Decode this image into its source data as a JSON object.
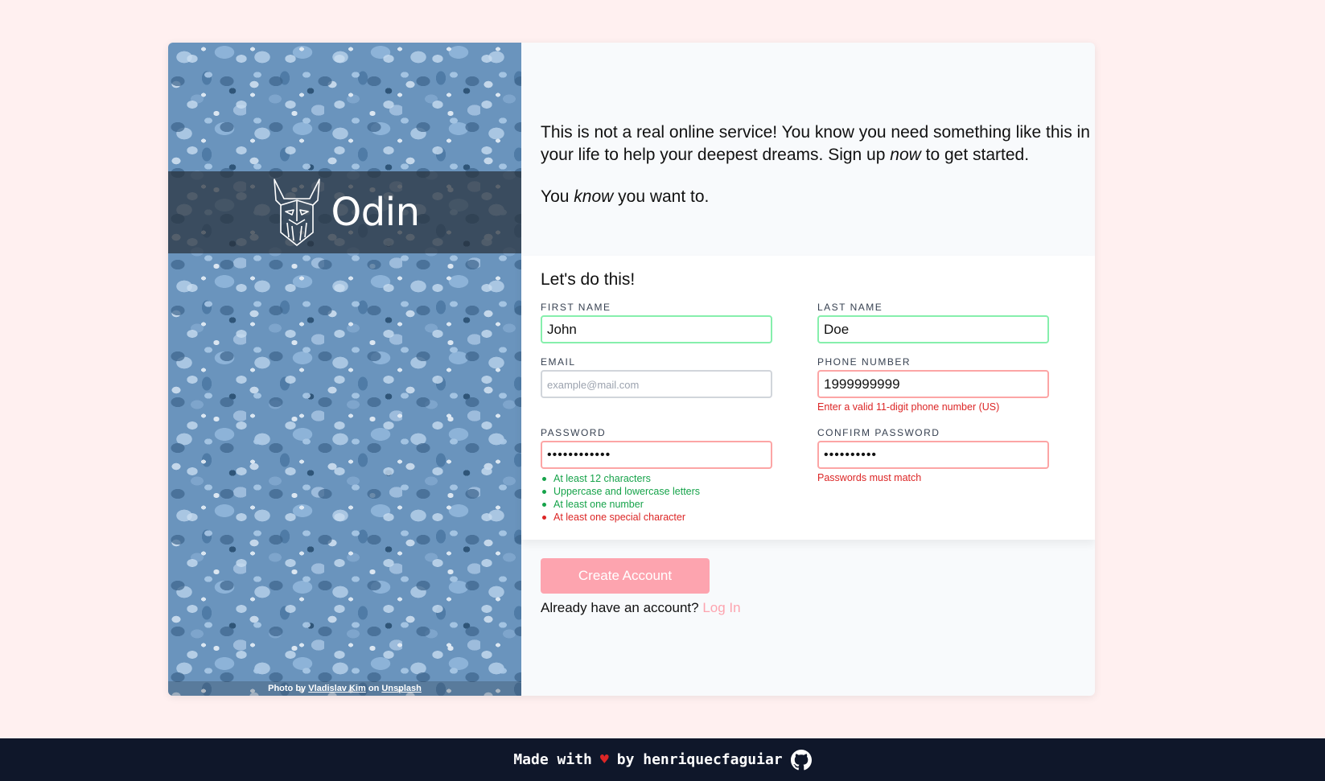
{
  "hero": {
    "brand_name": "Odin",
    "credit_prefix": "Photo by",
    "credit_author": "Vladislav Kim",
    "credit_mid": "on",
    "credit_site": "Unsplash"
  },
  "intro": {
    "line1_a": "This is not a real online service! You know you need something like this in your life to help your deepest dreams. Sign up ",
    "line1_em": "now",
    "line1_b": " to get started.",
    "line2_a": "You ",
    "line2_em": "know",
    "line2_b": " you want to."
  },
  "form": {
    "title": "Let's do this!",
    "first_name": {
      "label": "FIRST NAME",
      "value": "John"
    },
    "last_name": {
      "label": "LAST NAME",
      "value": "Doe"
    },
    "email": {
      "label": "EMAIL",
      "value": "",
      "placeholder": "example@mail.com"
    },
    "phone": {
      "label": "PHONE NUMBER",
      "value": "1999999999",
      "error": "Enter a valid 11-digit phone number (US)"
    },
    "password": {
      "label": "PASSWORD",
      "value": "••••••••••••",
      "rules": [
        {
          "text": "At least 12 characters",
          "status": "ok"
        },
        {
          "text": "Uppercase and lowercase letters",
          "status": "ok"
        },
        {
          "text": "At least one number",
          "status": "ok"
        },
        {
          "text": "At least one special character",
          "status": "bad"
        }
      ]
    },
    "confirm_password": {
      "label": "CONFIRM PASSWORD",
      "value": "••••••••••",
      "error": "Passwords must match"
    }
  },
  "actions": {
    "create_label": "Create Account",
    "login_prompt": "Already have an account?",
    "login_link": "Log In"
  },
  "footer": {
    "made_with": "Made with",
    "heart": "♥",
    "by": "by henriquecfaguiar"
  },
  "colors": {
    "background": "#fff0f0",
    "valid": "#86efac",
    "invalid": "#fca5a5",
    "accent": "#fda4af",
    "footer": "#0f172a"
  },
  "icons": {
    "brand": "odin-logo-icon",
    "footer": "github-icon"
  }
}
